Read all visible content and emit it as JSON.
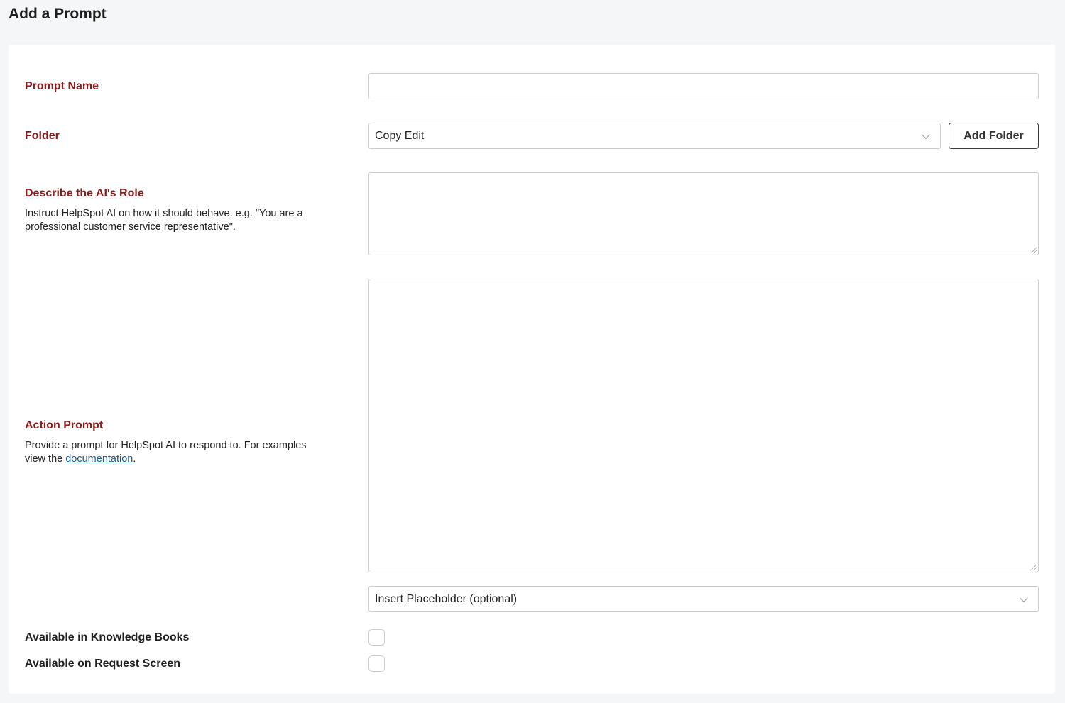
{
  "page": {
    "title": "Add a Prompt"
  },
  "form": {
    "prompt_name": {
      "label": "Prompt Name",
      "value": ""
    },
    "folder": {
      "label": "Folder",
      "selected": "Copy Edit",
      "add_button": "Add Folder"
    },
    "role": {
      "label": "Describe the AI's Role",
      "description": "Instruct HelpSpot AI on how it should behave. e.g. \"You are a professional customer service representative\".",
      "value": ""
    },
    "action": {
      "label": "Action Prompt",
      "description_before": "Provide a prompt for HelpSpot AI to respond to. For examples view the ",
      "link_text": "documentation",
      "description_after": ".",
      "value": "",
      "placeholder_select": "Insert Placeholder (optional)"
    },
    "knowledge_books": {
      "label": "Available in Knowledge Books",
      "checked": false
    },
    "request_screen": {
      "label": "Available on Request Screen",
      "checked": false
    }
  },
  "icons": {
    "select_arrow": "chevron-down-icon",
    "textarea_resize": "resize-handle-icon"
  }
}
